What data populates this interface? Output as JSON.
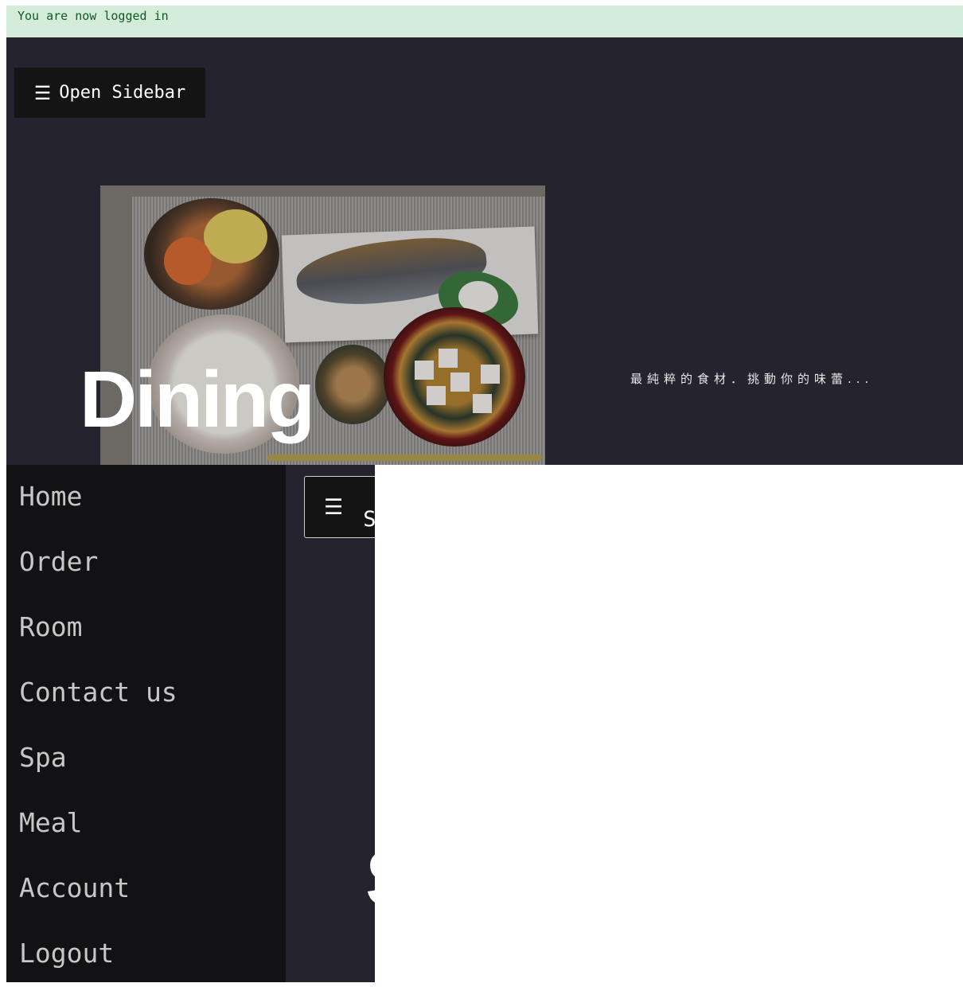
{
  "alert": {
    "message": "You are now logged in"
  },
  "header": {
    "open_sidebar_icon": "hamburger-icon",
    "open_sidebar_label": "Open Sidebar"
  },
  "hero": {
    "title": "Dining",
    "tagline": "最純粹的食材．挑動你的味蕾..."
  },
  "sidebar": {
    "items": [
      {
        "label": "Home"
      },
      {
        "label": "Order"
      },
      {
        "label": "Room"
      },
      {
        "label": "Contact us"
      },
      {
        "label": "Spa"
      },
      {
        "label": "Meal"
      },
      {
        "label": "Account"
      },
      {
        "label": "Logout"
      }
    ]
  },
  "overlay": {
    "open_button_label": "Open Sidebar"
  },
  "colors": {
    "alert_bg": "#d4edda",
    "alert_text": "#155724",
    "hero_bg": "#24232e",
    "sidebar_bg": "#121214",
    "sidebar_text": "#c7c7c7"
  }
}
